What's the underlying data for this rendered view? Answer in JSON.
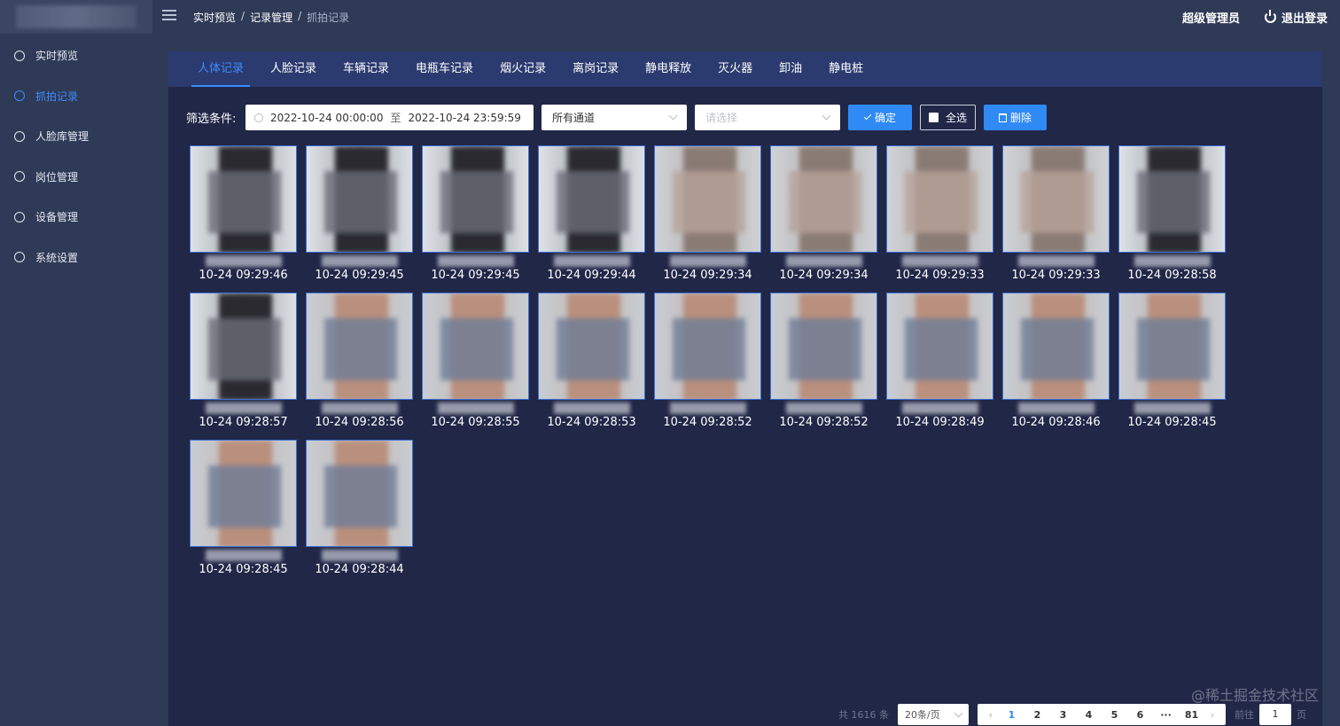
{
  "header": {
    "breadcrumb": [
      "实时预览",
      "记录管理",
      "抓拍记录"
    ],
    "separator": "/",
    "user_name": "超级管理员",
    "logout_label": "退出登录"
  },
  "sidebar": {
    "items": [
      {
        "label": "实时预览",
        "icon": "play-icon"
      },
      {
        "label": "抓拍记录",
        "icon": "camera-icon",
        "active": true
      },
      {
        "label": "人脸库管理",
        "icon": "gear-icon"
      },
      {
        "label": "岗位管理",
        "icon": "user-icon"
      },
      {
        "label": "设备管理",
        "icon": "device-icon"
      },
      {
        "label": "系统设置",
        "icon": "settings-icon"
      }
    ]
  },
  "tabs": [
    "人体记录",
    "人脸记录",
    "车辆记录",
    "电瓶车记录",
    "烟火记录",
    "离岗记录",
    "静电释放",
    "灭火器",
    "卸油",
    "静电桩"
  ],
  "filter": {
    "label": "筛选条件:",
    "start_date": "2022-10-24 00:00:00",
    "range_sep": "至",
    "end_date": "2022-10-24 23:59:59",
    "channel": "所有通道",
    "second_placeholder": "请选择",
    "confirm_label": "确定",
    "select_all_label": "全选",
    "delete_label": "删除"
  },
  "records": [
    {
      "time": "10-24 09:29:46",
      "tone": "dark"
    },
    {
      "time": "10-24 09:29:45",
      "tone": "dark"
    },
    {
      "time": "10-24 09:29:45",
      "tone": "dark"
    },
    {
      "time": "10-24 09:29:44",
      "tone": "dark"
    },
    {
      "time": "10-24 09:29:34",
      "tone": "mixed"
    },
    {
      "time": "10-24 09:29:34",
      "tone": "mixed"
    },
    {
      "time": "10-24 09:29:33",
      "tone": "mixed"
    },
    {
      "time": "10-24 09:29:33",
      "tone": "mixed"
    },
    {
      "time": "10-24 09:28:58",
      "tone": "dark"
    },
    {
      "time": "10-24 09:28:57",
      "tone": "dark"
    },
    {
      "time": "10-24 09:28:56",
      "tone": "skin"
    },
    {
      "time": "10-24 09:28:55",
      "tone": "skin"
    },
    {
      "time": "10-24 09:28:53",
      "tone": "skin"
    },
    {
      "time": "10-24 09:28:52",
      "tone": "skin"
    },
    {
      "time": "10-24 09:28:52",
      "tone": "skin"
    },
    {
      "time": "10-24 09:28:49",
      "tone": "skin"
    },
    {
      "time": "10-24 09:28:46",
      "tone": "skin"
    },
    {
      "time": "10-24 09:28:45",
      "tone": "skin"
    },
    {
      "time": "10-24 09:28:45",
      "tone": "skin"
    },
    {
      "time": "10-24 09:28:44",
      "tone": "skin"
    }
  ],
  "pagination": {
    "total": "共 1616 条",
    "page_size": "20条/页",
    "pages": [
      "1",
      "2",
      "3",
      "4",
      "5",
      "6",
      "···",
      "81"
    ],
    "current": "1",
    "goto_prefix": "前往",
    "goto_value": "1",
    "goto_suffix": "页"
  },
  "watermark": "@稀土掘金技术社区",
  "colors": {
    "accent": "#3d8bff",
    "button": "#2f8af5",
    "panel": "#212747",
    "sidebar": "#2f3a56"
  }
}
